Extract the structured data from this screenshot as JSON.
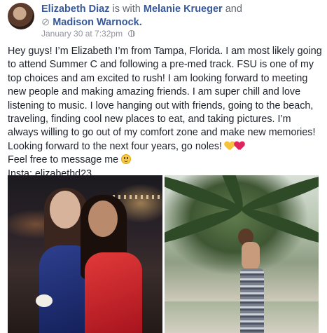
{
  "post": {
    "author": "Elizabeth Diaz",
    "with_word": "is with",
    "tagged_1": "Melanie Krueger",
    "and_word": "and",
    "tagged_2": "Madison Warnock.",
    "timestamp": "January 30 at 7:32pm",
    "privacy_icon": "globe-icon",
    "body": {
      "main": "Hey guys! I’m Elizabeth I’m from Tampa, Florida. I am most likely going to attend Summer C and following a pre-med track. FSU is one of my top choices and am excited to rush! I am looking forward to meeting new people and making amazing friends. I am super chill and love listening to music. I love hanging out with friends, going to the beach, traveling, finding cool new places to eat, and taking pictures. I’m always willing to go out of my comfort zone and make new memories! Looking forward to the next four years, go noles!",
      "line2": "Feel free to message me",
      "line3": "Insta: elizabethd23"
    },
    "emojis": [
      "yellow-heart-icon",
      "red-heart-icon",
      "smiley-icon"
    ],
    "photos": [
      {
        "name": "photo-left",
        "subject": "two girls in dresses at night"
      },
      {
        "name": "photo-right",
        "subject": "girl by palm tree at beach"
      }
    ]
  }
}
